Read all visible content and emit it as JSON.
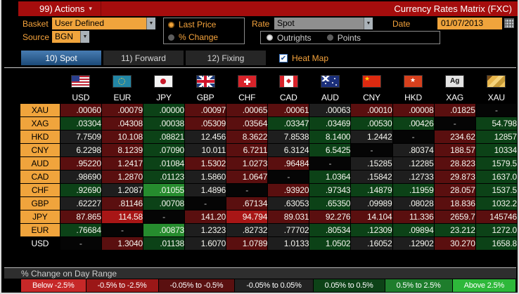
{
  "titlebar": {
    "actions": "99) Actions",
    "title": "Currency Rates Matrix (FXC)"
  },
  "icons": {
    "caret": "▾",
    "dropdown_arrow": "▼",
    "check": "✔"
  },
  "controls": {
    "basket": {
      "label": "Basket",
      "value": "User Defined"
    },
    "source": {
      "label": "Source",
      "value": "BGN"
    },
    "price_mode": {
      "options": [
        "Last Price",
        "% Change"
      ],
      "selected": 0
    },
    "rate": {
      "label": "Rate",
      "value": "Spot"
    },
    "rate_mode": {
      "options": [
        "Outrights",
        "Points"
      ],
      "selected": 0
    },
    "date": {
      "label": "Date",
      "value": "01/07/2013"
    }
  },
  "tabs": [
    {
      "label": "10) Spot",
      "active": true
    },
    {
      "label": "11) Forward",
      "active": false
    },
    {
      "label": "12) Fixing",
      "active": false
    }
  ],
  "heatmap": {
    "label": "Heat Map",
    "checked": true
  },
  "colors": {
    "titlebar_red": "#a50d0d",
    "accent_orange": "#f0a43c",
    "tab_active_blue": "#2c5d8f"
  },
  "heat_colors": {
    "r2": "#a81616",
    "r1": "#5a0f0f",
    "n": "#1e1e1e",
    "g1": "#0c4217",
    "g2": "#268c2e",
    "x": "#050505"
  },
  "matrix": {
    "columns": [
      {
        "code": "USD",
        "flag": "usd"
      },
      {
        "code": "EUR",
        "flag": "eur"
      },
      {
        "code": "JPY",
        "flag": "jpy"
      },
      {
        "code": "GBP",
        "flag": "gbp"
      },
      {
        "code": "CHF",
        "flag": "chf"
      },
      {
        "code": "CAD",
        "flag": "cad"
      },
      {
        "code": "AUD",
        "flag": "aud"
      },
      {
        "code": "CNY",
        "flag": "cny"
      },
      {
        "code": "HKD",
        "flag": "hkd"
      },
      {
        "code": "XAG",
        "flag": "xag",
        "flag_label": "Ag"
      },
      {
        "code": "XAU",
        "flag": "xau"
      }
    ],
    "rows": [
      {
        "label": "XAU",
        "label_style": "orange",
        "values": [
          ".00060",
          ".00079",
          ".00000",
          ".00097",
          ".00065",
          ".00061",
          ".00063",
          ".00010",
          ".00008",
          ".01825",
          "-"
        ],
        "heat": [
          "r1",
          "r1",
          "g1",
          "r1",
          "r1",
          "r1",
          "n",
          "r1",
          "r1",
          "r1",
          "x"
        ]
      },
      {
        "label": "XAG",
        "label_style": "orange",
        "values": [
          ".03304",
          ".04308",
          ".00038",
          ".05309",
          ".03564",
          ".03347",
          ".03469",
          ".00530",
          ".00426",
          "-",
          "54.798"
        ],
        "heat": [
          "g1",
          "r1",
          "g1",
          "r1",
          "r1",
          "g1",
          "g1",
          "g1",
          "g1",
          "x",
          "g1"
        ]
      },
      {
        "label": "HKD",
        "label_style": "orange",
        "values": [
          "7.7509",
          "10.108",
          ".08821",
          "12.456",
          "8.3622",
          "7.8538",
          "8.1400",
          "1.2442",
          "-",
          "234.62",
          "12857"
        ],
        "heat": [
          "n",
          "r1",
          "g1",
          "n",
          "r1",
          "n",
          "g1",
          "n",
          "x",
          "r1",
          "g1"
        ]
      },
      {
        "label": "CNY",
        "label_style": "orange",
        "values": [
          "6.2298",
          "8.1239",
          ".07090",
          "10.011",
          "6.7211",
          "6.3124",
          "6.5425",
          "-",
          ".80374",
          "188.57",
          "10334"
        ],
        "heat": [
          "n",
          "r1",
          "g1",
          "n",
          "r1",
          "n",
          "g1",
          "x",
          "n",
          "r1",
          "g1"
        ]
      },
      {
        "label": "AUD",
        "label_style": "orange",
        "values": [
          ".95220",
          "1.2417",
          ".01084",
          "1.5302",
          "1.0273",
          ".96484",
          "-",
          ".15285",
          ".12285",
          "28.823",
          "1579.5"
        ],
        "heat": [
          "r1",
          "r1",
          "g1",
          "r1",
          "r1",
          "r1",
          "x",
          "n",
          "n",
          "r1",
          "g1"
        ]
      },
      {
        "label": "CAD",
        "label_style": "orange",
        "values": [
          ".98690",
          "1.2870",
          ".01123",
          "1.5860",
          "1.0647",
          "-",
          "1.0364",
          ".15842",
          ".12733",
          "29.873",
          "1637.0"
        ],
        "heat": [
          "n",
          "r1",
          "g1",
          "n",
          "r1",
          "x",
          "g1",
          "n",
          "n",
          "r1",
          "g1"
        ]
      },
      {
        "label": "CHF",
        "label_style": "orange",
        "values": [
          ".92690",
          "1.2087",
          ".01055",
          "1.4896",
          "-",
          ".93920",
          ".97343",
          ".14879",
          ".11959",
          "28.057",
          "1537.5"
        ],
        "heat": [
          "g1",
          "n",
          "g2",
          "n",
          "x",
          "r1",
          "g1",
          "g1",
          "g1",
          "r1",
          "g1"
        ]
      },
      {
        "label": "GBP",
        "label_style": "orange",
        "values": [
          ".62227",
          ".81146",
          ".00708",
          "-",
          ".67134",
          ".63053",
          ".65350",
          ".09989",
          ".08028",
          "18.836",
          "1032.2"
        ],
        "heat": [
          "n",
          "r1",
          "g1",
          "x",
          "r1",
          "n",
          "g1",
          "n",
          "n",
          "r1",
          "g1"
        ]
      },
      {
        "label": "JPY",
        "label_style": "orange",
        "values": [
          "87.865",
          "114.58",
          "-",
          "141.20",
          "94.794",
          "89.031",
          "92.276",
          "14.104",
          "11.336",
          "2659.7",
          "145746"
        ],
        "heat": [
          "r1",
          "r2",
          "x",
          "r1",
          "r2",
          "r1",
          "r1",
          "r1",
          "r1",
          "r1",
          "r1"
        ]
      },
      {
        "label": "EUR",
        "label_style": "orange",
        "values": [
          ".76684",
          "-",
          ".00873",
          "1.2323",
          ".82732",
          ".77702",
          ".80534",
          ".12309",
          ".09894",
          "23.212",
          "1272.0"
        ],
        "heat": [
          "g1",
          "x",
          "g2",
          "n",
          "n",
          "n",
          "g1",
          "g1",
          "g1",
          "g1",
          "g1"
        ]
      },
      {
        "label": "USD",
        "label_style": "plain",
        "values": [
          "-",
          "1.3040",
          ".01138",
          "1.6070",
          "1.0789",
          "1.0133",
          "1.0502",
          ".16052",
          ".12902",
          "30.270",
          "1658.8"
        ],
        "heat": [
          "x",
          "r1",
          "g1",
          "n",
          "r1",
          "n",
          "g1",
          "n",
          "n",
          "r1",
          "g1"
        ]
      }
    ]
  },
  "legend": {
    "title": "% Change on Day Range",
    "items": [
      {
        "label": "Below -2.5%",
        "color": "#c62828"
      },
      {
        "label": "-0.5% to -2.5%",
        "color": "#9b1717"
      },
      {
        "label": "-0.05% to -0.5%",
        "color": "#5a1010"
      },
      {
        "label": "-0.05% to 0.05%",
        "color": "#222222"
      },
      {
        "label": "0.05% to 0.5%",
        "color": "#0d4217"
      },
      {
        "label": "0.5% to 2.5%",
        "color": "#1e7d2c"
      },
      {
        "label": "Above 2.5%",
        "color": "#2eb83a"
      }
    ]
  }
}
